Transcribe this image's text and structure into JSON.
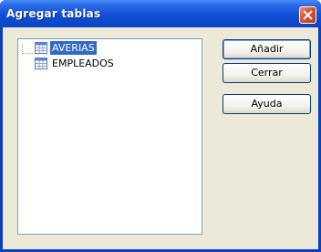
{
  "window": {
    "title": "Agregar tablas"
  },
  "tables": [
    {
      "name": "AVERIAS",
      "selected": true,
      "icon": "table-icon"
    },
    {
      "name": "EMPLEADOS",
      "selected": false,
      "icon": "table-icon"
    }
  ],
  "buttons": {
    "add_label": "Añadir",
    "close_label": "Cerrar",
    "help_label": "Ayuda"
  },
  "colors": {
    "titlebar": "#0a44c4",
    "selection": "#316ac5",
    "dialog_face": "#ece9d8"
  },
  "icons": {
    "close": "close-icon"
  }
}
